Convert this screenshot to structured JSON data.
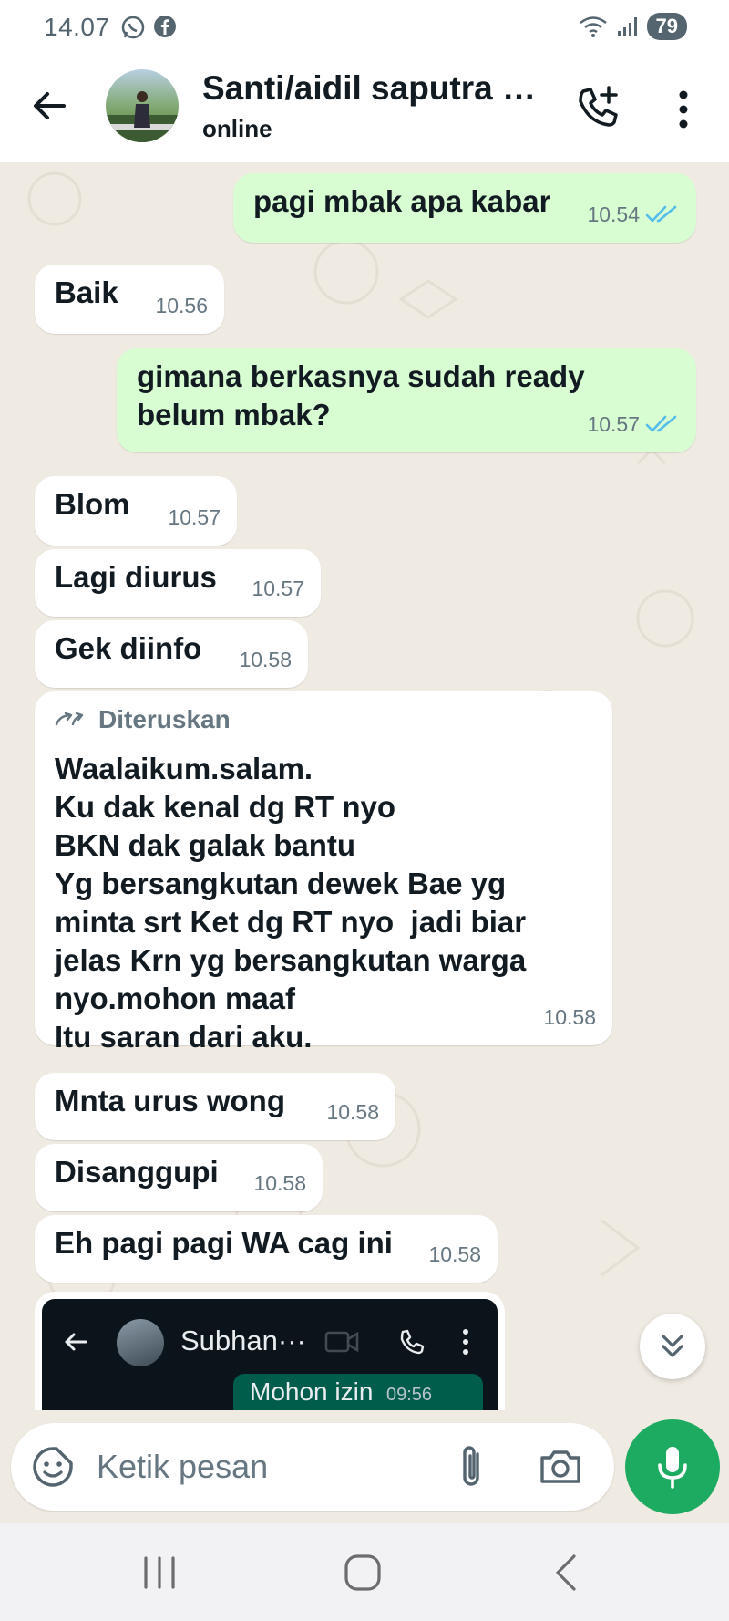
{
  "status_bar": {
    "time": "14.07",
    "left_icons": [
      "whatsapp-icon",
      "facebook-icon"
    ],
    "right_icons": [
      "wifi-icon",
      "signal-icon"
    ],
    "battery": "79"
  },
  "header": {
    "contact_name": "Santi/aidil saputra B...",
    "status": "online",
    "icons": [
      "back-arrow-icon",
      "add-call-icon",
      "more-vert-icon"
    ]
  },
  "messages": [
    {
      "direction": "out",
      "text": "pagi mbak apa kabar",
      "time": "10.54",
      "read": true
    },
    {
      "direction": "in",
      "text": "Baik",
      "time": "10.56"
    },
    {
      "direction": "out",
      "text": "gimana berkasnya sudah ready\nbelum mbak?",
      "time": "10.57",
      "read": true
    },
    {
      "direction": "in",
      "text": "Blom",
      "time": "10.57"
    },
    {
      "direction": "in",
      "text": "Lagi diurus",
      "time": "10.57"
    },
    {
      "direction": "in",
      "text": "Gek diinfo",
      "time": "10.58"
    },
    {
      "direction": "in",
      "forwarded_label": "Diteruskan",
      "text": "Waalaikum.salam.\nKu dak kenal dg RT nyo\nBKN dak galak bantu\nYg bersangkutan dewek Bae yg\nminta srt Ket dg RT nyo  jadi biar\njelas Krn yg bersangkutan warga\nnyo.mohon maaf\nItu saran dari aku.",
      "time": "10.58"
    },
    {
      "direction": "in",
      "text": "Mnta urus wong",
      "time": "10.58"
    },
    {
      "direction": "in",
      "text": "Disanggupi",
      "time": "10.58"
    },
    {
      "direction": "in",
      "text": "Eh pagi pagi WA cag ini",
      "time": "10.58"
    }
  ],
  "media_preview": {
    "contact": "Subhan···",
    "message": "Mohon izin",
    "time": "09:56"
  },
  "composer": {
    "placeholder": "Ketik pesan"
  },
  "colors": {
    "chat_background": "#efeae2",
    "outgoing_bubble": "#d9fdd3",
    "incoming_bubble": "#ffffff",
    "read_ticks": "#53bdeb",
    "mic_button": "#1daa61"
  }
}
